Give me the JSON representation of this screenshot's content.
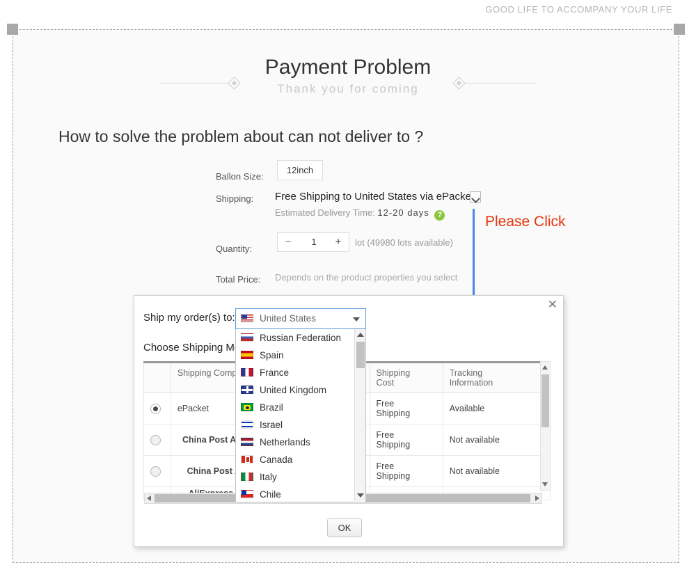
{
  "tagline": "GOOD LIFE TO ACCOMPANY YOUR LIFE",
  "header": {
    "title": "Payment Problem",
    "subtitle": "Thank you for coming",
    "question": "How to solve the problem about can not deliver to ?"
  },
  "form": {
    "size_label": "Ballon Size:",
    "size_value": "12inch",
    "shipping_label": "Shipping:",
    "shipping_value": "Free Shipping to United States via ePacket",
    "edt_prefix": "Estimated Delivery Time:",
    "edt_days": "12-20 days",
    "help_icon": "?",
    "quantity_label": "Quantity:",
    "quantity_minus": "−",
    "quantity_value": "1",
    "quantity_plus": "+",
    "quantity_note": "lot (49980 lots available)",
    "price_label": "Total Price:",
    "price_value": "Depends on the product properties you select"
  },
  "annotation": {
    "text": "Please Click",
    "color": "#e8340c",
    "arrow_color": "#4a86e8"
  },
  "dialog": {
    "close_icon": "✕",
    "ship_to_label": "Ship my order(s) to:",
    "choose_label": "Choose Shipping Me",
    "ok_label": "OK",
    "selected_country": "United States",
    "selected_country_flag": "f-us",
    "country_options": [
      {
        "name": "Russian Federation",
        "flag": "f-ru"
      },
      {
        "name": "Spain",
        "flag": "f-es"
      },
      {
        "name": "France",
        "flag": "f-fr"
      },
      {
        "name": "United Kingdom",
        "flag": "f-gb"
      },
      {
        "name": "Brazil",
        "flag": "f-br"
      },
      {
        "name": "Israel",
        "flag": "f-il"
      },
      {
        "name": "Netherlands",
        "flag": "f-nl"
      },
      {
        "name": "Canada",
        "flag": "f-ca"
      },
      {
        "name": "Italy",
        "flag": "f-it"
      },
      {
        "name": "Chile",
        "flag": "f-cl"
      }
    ],
    "table": {
      "headers": [
        "",
        "Shipping Compan",
        "",
        "Shipping Cost",
        "Tracking Information"
      ],
      "header_company": "Shipping Compan",
      "header_cost_line1": "Shipping",
      "header_cost_line2": "Cost",
      "header_track_line1": "Tracking",
      "header_track_line2": "Information",
      "rows": [
        {
          "selected": true,
          "company": "ePacket",
          "bold": false,
          "cost_line1": "Free",
          "cost_line2": "Shipping",
          "tracking": "Available"
        },
        {
          "selected": false,
          "company": "China Post Air Parcel",
          "bold": true,
          "cost_line1": "Free",
          "cost_line2": "Shipping",
          "tracking": "Not available"
        },
        {
          "selected": false,
          "company": "China Post Air Mail",
          "bold": true,
          "cost_line1": "Free",
          "cost_line2": "Shipping",
          "tracking": "Not available"
        },
        {
          "selected": false,
          "company": "AliExpress Standa",
          "bold": true,
          "cost_line1": "",
          "cost_line2": "",
          "tracking": ""
        }
      ]
    }
  }
}
